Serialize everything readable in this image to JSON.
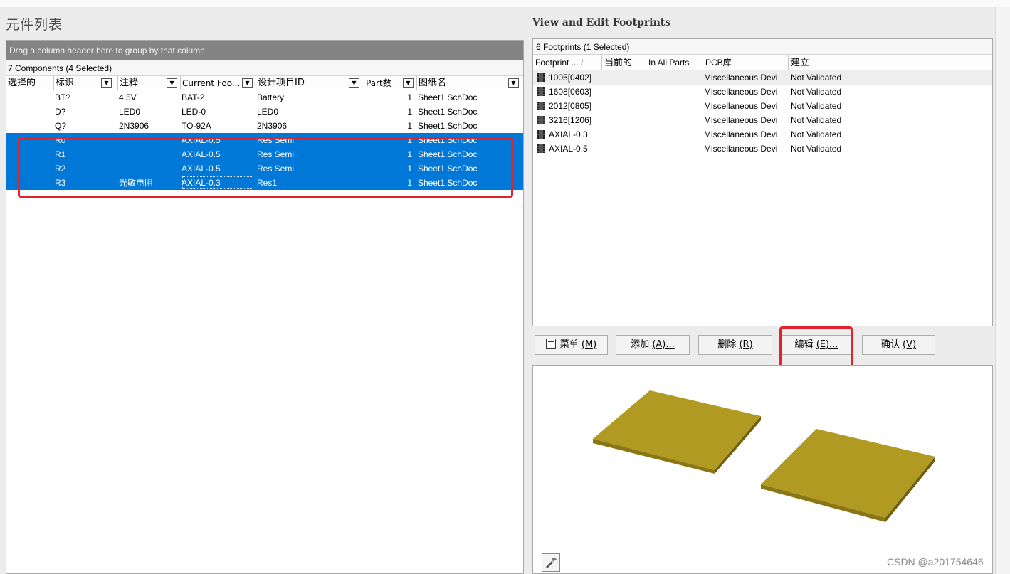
{
  "left": {
    "title": "元件列表",
    "group_hint": "Drag a column header here to group by that column",
    "count_text": "7 Components (4 Selected)",
    "columns": [
      "选择的",
      "标识",
      "注释",
      "Current Foo...",
      "设计项目ID",
      "Part数",
      "图纸名"
    ],
    "rows": [
      {
        "designator": "BT?",
        "comment": "4.5V",
        "footprint": "BAT-2",
        "design_id": "Battery",
        "parts": "1",
        "sheet": "Sheet1.SchDoc",
        "selected": false
      },
      {
        "designator": "D?",
        "comment": "LED0",
        "footprint": "LED-0",
        "design_id": "LED0",
        "parts": "1",
        "sheet": "Sheet1.SchDoc",
        "selected": false
      },
      {
        "designator": "Q?",
        "comment": "2N3906",
        "footprint": "TO-92A",
        "design_id": "2N3906",
        "parts": "1",
        "sheet": "Sheet1.SchDoc",
        "selected": false
      },
      {
        "designator": "R0",
        "comment": "",
        "footprint": "AXIAL-0.5",
        "design_id": "Res Semi",
        "parts": "1",
        "sheet": "Sheet1.SchDoc",
        "selected": true
      },
      {
        "designator": "R1",
        "comment": "",
        "footprint": "AXIAL-0.5",
        "design_id": "Res Semi",
        "parts": "1",
        "sheet": "Sheet1.SchDoc",
        "selected": true
      },
      {
        "designator": "R2",
        "comment": "",
        "footprint": "AXIAL-0.5",
        "design_id": "Res Semi",
        "parts": "1",
        "sheet": "Sheet1.SchDoc",
        "selected": true
      },
      {
        "designator": "R3",
        "comment": "光敏电阻",
        "footprint": "AXIAL-0.3",
        "design_id": "Res1",
        "parts": "1",
        "sheet": "Sheet1.SchDoc",
        "selected": true
      }
    ]
  },
  "right": {
    "title": "View and Edit Footprints",
    "count_text": "6 Footprints (1 Selected)",
    "columns": [
      "Footprint ...",
      "当前的",
      "In All Parts",
      "PCB库",
      "建立"
    ],
    "sort_glyph": "/",
    "rows": [
      {
        "name": "1005[0402]",
        "library": "Miscellaneous Devi",
        "status": "Not Validated",
        "selected": true
      },
      {
        "name": "1608[0603]",
        "library": "Miscellaneous Devi",
        "status": "Not Validated",
        "selected": false
      },
      {
        "name": "2012[0805]",
        "library": "Miscellaneous Devi",
        "status": "Not Validated",
        "selected": false
      },
      {
        "name": "3216[1206]",
        "library": "Miscellaneous Devi",
        "status": "Not Validated",
        "selected": false
      },
      {
        "name": "AXIAL-0.3",
        "library": "Miscellaneous Devi",
        "status": "Not Validated",
        "selected": false
      },
      {
        "name": "AXIAL-0.5",
        "library": "Miscellaneous Devi",
        "status": "Not Validated",
        "selected": false
      }
    ],
    "buttons": {
      "menu": {
        "label": "菜单 ",
        "key": "(M)"
      },
      "add": {
        "label": "添加 ",
        "key": "(A)..."
      },
      "delete": {
        "label": "删除 ",
        "key": "(R)"
      },
      "edit": {
        "label": "编辑 ",
        "key": "(E)..."
      },
      "validate": {
        "label": "确认 ",
        "key": "(V)"
      }
    }
  },
  "colors": {
    "selection": "#0078d7",
    "highlight_box": "#e0242b",
    "pad": "#b09a22"
  },
  "icons": [
    "filter-dropdown-icon",
    "footprint-chip-icon",
    "menu-icon",
    "wrench-icon"
  ],
  "watermark": "CSDN @a201754646"
}
